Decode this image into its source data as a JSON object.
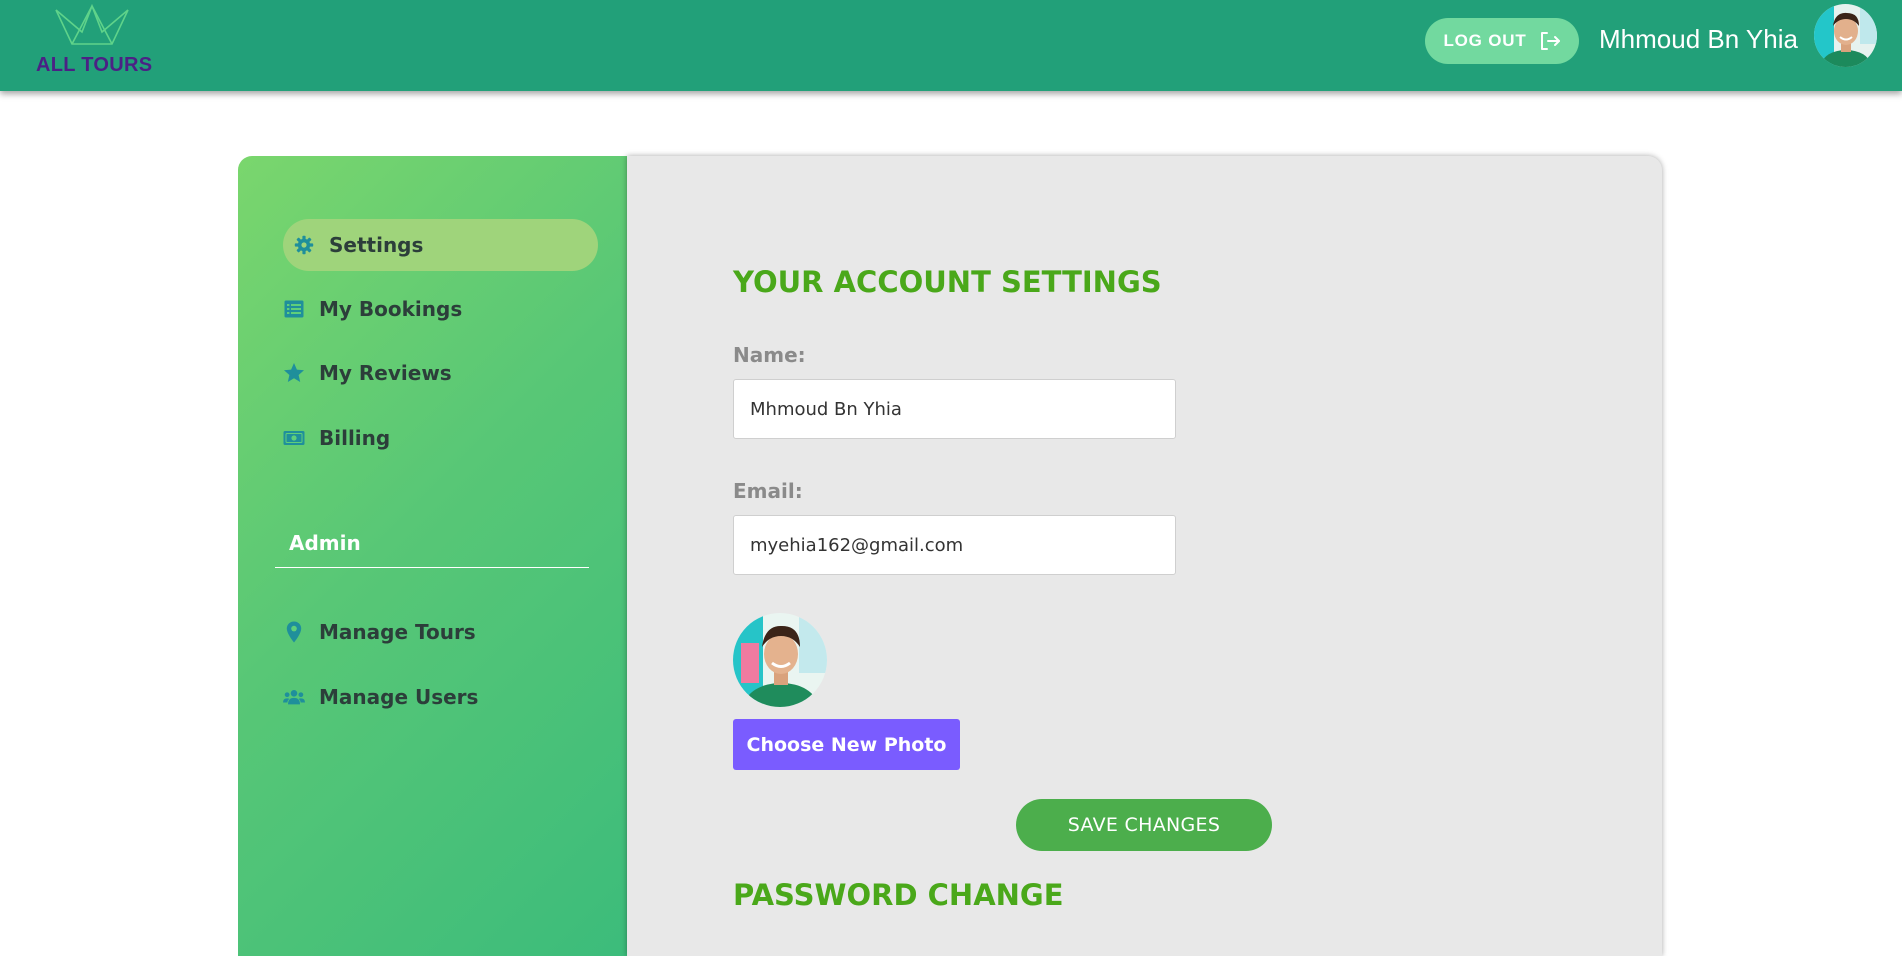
{
  "header": {
    "logo_text": "ALL TOURS",
    "logout_label": "LOG OUT",
    "user_name": "Mhmoud Bn Yhia"
  },
  "sidebar": {
    "items": [
      {
        "label": "Settings",
        "icon": "gear-icon",
        "active": true
      },
      {
        "label": "My Bookings",
        "icon": "list-icon",
        "active": false
      },
      {
        "label": "My Reviews",
        "icon": "star-icon",
        "active": false
      },
      {
        "label": "Billing",
        "icon": "money-icon",
        "active": false
      }
    ],
    "admin_title": "Admin",
    "admin_items": [
      {
        "label": "Manage Tours",
        "icon": "map-pin-icon"
      },
      {
        "label": "Manage Users",
        "icon": "users-icon"
      }
    ]
  },
  "account": {
    "title": "YOUR ACCOUNT SETTINGS",
    "name_label": "Name:",
    "name_value": "Mhmoud Bn Yhia",
    "email_label": "Email:",
    "email_value": "myehia162@gmail.com",
    "photo_button": "Choose New Photo",
    "save_button": "SAVE CHANGES"
  },
  "password": {
    "title": "PASSWORD CHANGE"
  },
  "colors": {
    "header_bg": "#22a079",
    "accent_green": "#4aa81a",
    "photo_button": "#7a5cff",
    "save_button": "#4cae4c",
    "nav_icon": "#1f8f9b"
  }
}
